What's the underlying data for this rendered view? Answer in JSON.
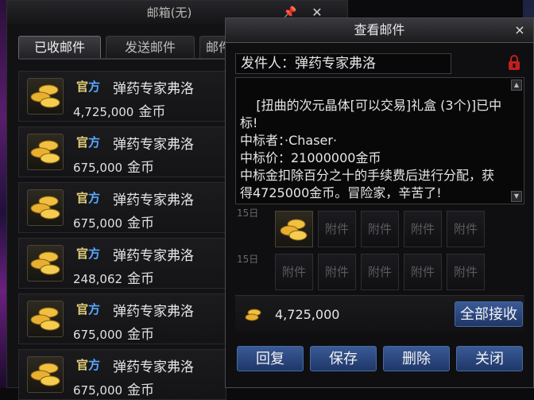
{
  "mailbox": {
    "title": "邮箱(无)",
    "tabs": [
      "已收邮件",
      "发送邮件",
      "邮件"
    ],
    "mails": [
      {
        "tag_a": "官",
        "tag_b": "方",
        "sender": "弹药专家弗洛",
        "amount": "4,725,000",
        "unit": "金币"
      },
      {
        "tag_a": "官",
        "tag_b": "方",
        "sender": "弹药专家弗洛",
        "amount": "675,000",
        "unit": "金币"
      },
      {
        "tag_a": "官",
        "tag_b": "方",
        "sender": "弹药专家弗洛",
        "amount": "675,000",
        "unit": "金币"
      },
      {
        "tag_a": "官",
        "tag_b": "方",
        "sender": "弹药专家弗洛",
        "amount": "248,062",
        "unit": "金币"
      },
      {
        "tag_a": "官",
        "tag_b": "方",
        "sender": "弹药专家弗洛",
        "amount": "675,000",
        "unit": "金币"
      },
      {
        "tag_a": "官",
        "tag_b": "方",
        "sender": "弹药专家弗洛",
        "amount": "675,000",
        "unit": "金币"
      }
    ]
  },
  "dialog": {
    "title": "查看邮件",
    "close": "×",
    "sender_line": "发件人：弹药专家弗洛",
    "body": "[扭曲的次元晶体[可以交易]礼盒 (3个)]已中标!\n中标者：·Chaser·\n中标价：21000000金币\n中标金扣除百分之十的手续费后进行分配，获得4725000金币。冒险家，辛苦了!",
    "attach_label": "附件",
    "day_label": "15日",
    "gold_amount": "4,725,000",
    "receive_all": "全部接收",
    "buttons": [
      "回复",
      "保存",
      "删除",
      "关闭"
    ]
  },
  "colors": {
    "accent_button": "#2a4a86",
    "official_tag_gold": "#e8d27a",
    "official_tag_blue": "#5aa8ff"
  }
}
